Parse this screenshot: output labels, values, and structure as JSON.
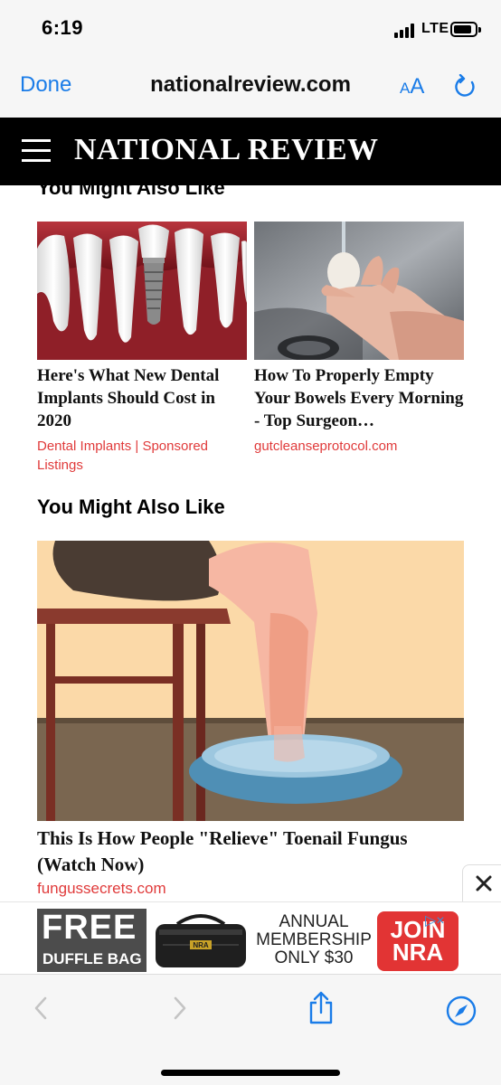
{
  "status": {
    "time": "6:19",
    "network": "LTE"
  },
  "browser": {
    "done_label": "Done",
    "url": "nationalreview.com",
    "text_size_small": "A",
    "text_size_large": "A"
  },
  "site": {
    "brand": "NATIONAL REVIEW"
  },
  "section_top": {
    "title": "You Might Also Like"
  },
  "cards": [
    {
      "title": "Here's What New Dental Implants Should Cost in 2020",
      "source": "Dental Implants | Sponsored Listings"
    },
    {
      "title": "How To Properly Empty Your Bowels Every Morning - Top Surgeon…",
      "source": "gutcleanseprotocol.com"
    }
  ],
  "section_second": {
    "title": "You Might Also Like"
  },
  "feature": {
    "title": "This Is How People \"Relieve\" Toenail Fungus (Watch Now)",
    "source": "fungussecrets.com"
  },
  "ad": {
    "free": "FREE",
    "duffle": "DUFFLE BAG",
    "line1": "ANNUAL",
    "line2": "MEMBERSHIP",
    "line3": "ONLY $30",
    "join1": "JOIN",
    "join2": "NRA",
    "bag_logo": "NRA",
    "adchoice": "▷×"
  },
  "colors": {
    "accent": "#1a7ce8",
    "source_red": "#e03a3a",
    "header_bg": "#000000"
  }
}
